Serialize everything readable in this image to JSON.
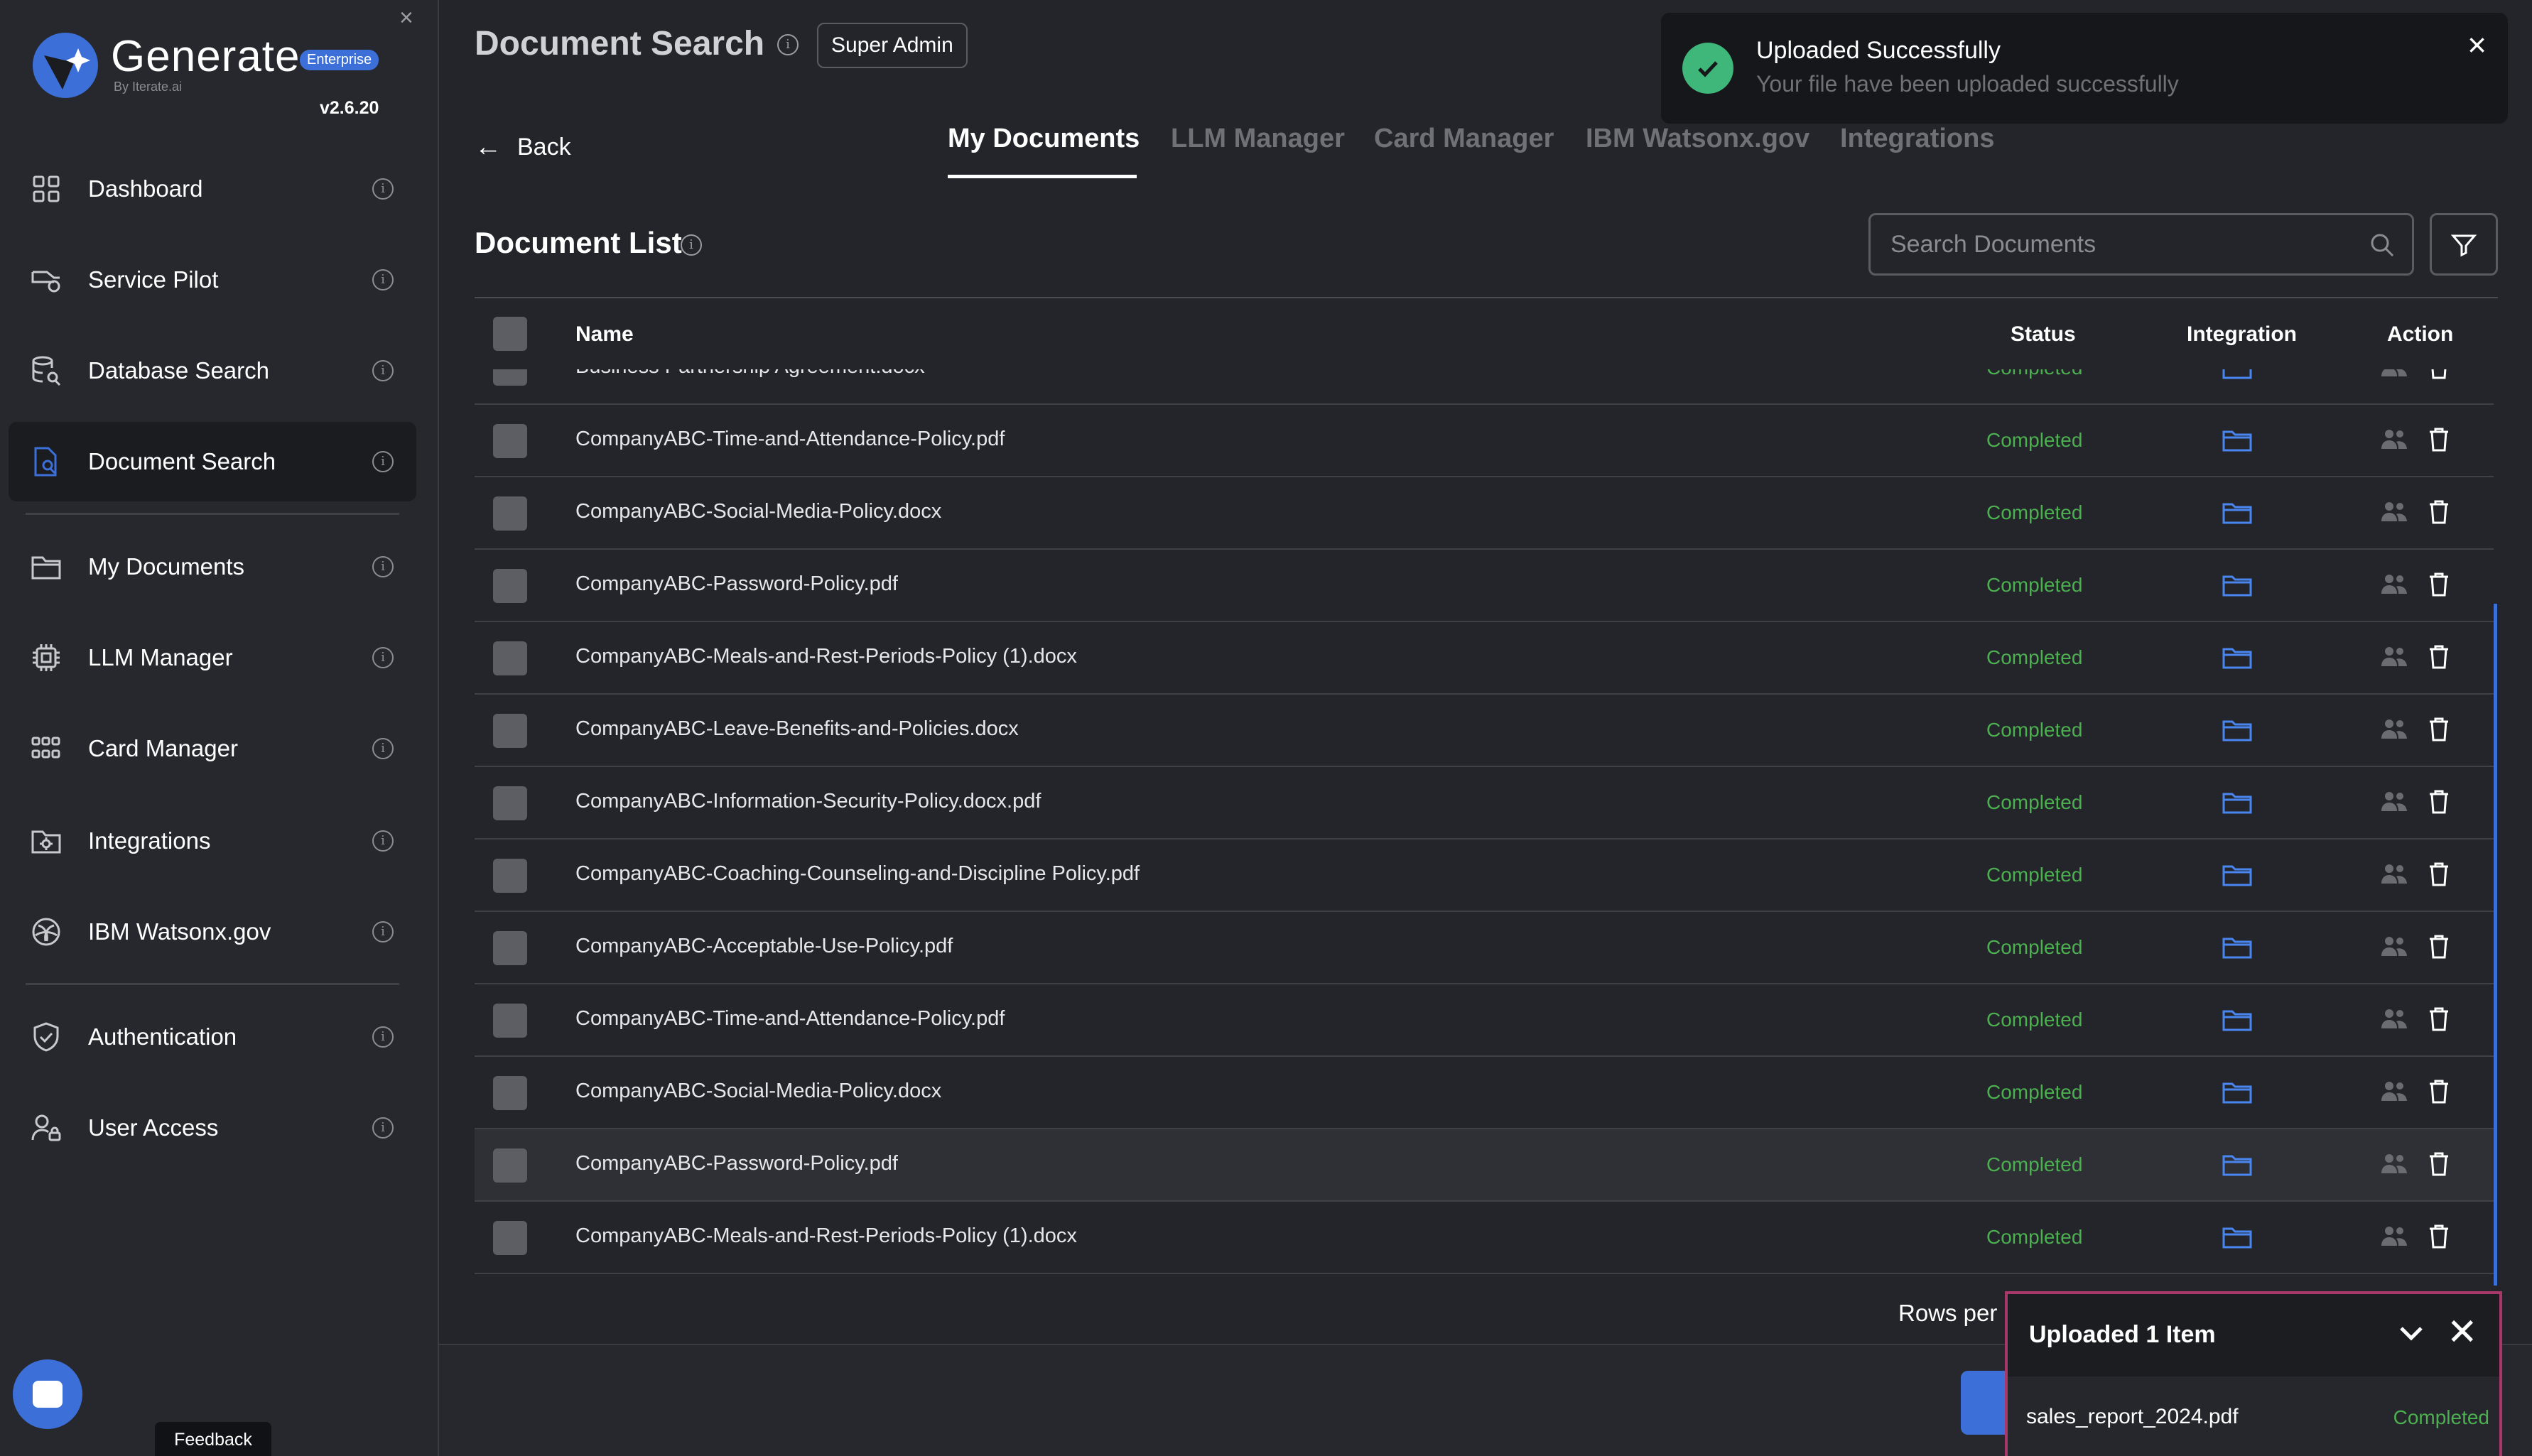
{
  "sidebar": {
    "brand": "Generate",
    "badge": "Enterprise",
    "byline": "By Iterate.ai",
    "version": "v2.6.20",
    "close_icon": "×",
    "items": [
      {
        "label": "Dashboard",
        "icon": "dashboard-icon"
      },
      {
        "label": "Service Pilot",
        "icon": "service-pilot-icon"
      },
      {
        "label": "Database Search",
        "icon": "database-search-icon"
      },
      {
        "label": "Document Search",
        "icon": "document-search-icon",
        "active": true
      },
      {
        "label": "My Documents",
        "icon": "folder-icon"
      },
      {
        "label": "LLM Manager",
        "icon": "chip-icon"
      },
      {
        "label": "Card Manager",
        "icon": "grid-icon"
      },
      {
        "label": "Integrations",
        "icon": "integrations-icon"
      },
      {
        "label": "IBM Watsonx.gov",
        "icon": "watsonx-icon"
      },
      {
        "label": "Authentication",
        "icon": "shield-icon"
      },
      {
        "label": "User Access",
        "icon": "user-access-icon"
      }
    ],
    "feedback": "Feedback"
  },
  "header": {
    "title": "Document Search",
    "role": "Super Admin"
  },
  "nav": {
    "back": "Back",
    "tabs": [
      "My Documents",
      "LLM Manager",
      "Card Manager",
      "IBM Watsonx.gov",
      "Integrations"
    ]
  },
  "list": {
    "title": "Document List",
    "search_placeholder": "Search Documents",
    "columns": {
      "name": "Name",
      "status": "Status",
      "integration": "Integration",
      "action": "Action"
    },
    "rows": [
      {
        "name": "Business Partnership Agreement.docx",
        "status": "Completed"
      },
      {
        "name": "CompanyABC-Time-and-Attendance-Policy.pdf",
        "status": "Completed"
      },
      {
        "name": "CompanyABC-Social-Media-Policy.docx",
        "status": "Completed"
      },
      {
        "name": "CompanyABC-Password-Policy.pdf",
        "status": "Completed"
      },
      {
        "name": "CompanyABC-Meals-and-Rest-Periods-Policy (1).docx",
        "status": "Completed"
      },
      {
        "name": "CompanyABC-Leave-Benefits-and-Policies.docx",
        "status": "Completed"
      },
      {
        "name": "CompanyABC-Information-Security-Policy.docx.pdf",
        "status": "Completed"
      },
      {
        "name": "CompanyABC-Coaching-Counseling-and-Discipline Policy.pdf",
        "status": "Completed"
      },
      {
        "name": "CompanyABC-Acceptable-Use-Policy.pdf",
        "status": "Completed"
      },
      {
        "name": "CompanyABC-Time-and-Attendance-Policy.pdf",
        "status": "Completed"
      },
      {
        "name": "CompanyABC-Social-Media-Policy.docx",
        "status": "Completed"
      },
      {
        "name": "CompanyABC-Password-Policy.pdf",
        "status": "Completed",
        "highlight": true
      },
      {
        "name": "CompanyABC-Meals-and-Rest-Periods-Policy (1).docx",
        "status": "Completed"
      }
    ],
    "rows_per_page_label": "Rows per"
  },
  "toast": {
    "title": "Uploaded Successfully",
    "message": "Your file have been uploaded successfully",
    "close": "×"
  },
  "upload_panel": {
    "title": "Uploaded 1 Item",
    "close": "✕",
    "file": "sales_report_2024.pdf",
    "status": "Completed"
  },
  "colors": {
    "accent": "#3d6fd8",
    "success": "#4caf50",
    "toast_check": "#3fb67a",
    "panel_border": "#a8386a"
  }
}
